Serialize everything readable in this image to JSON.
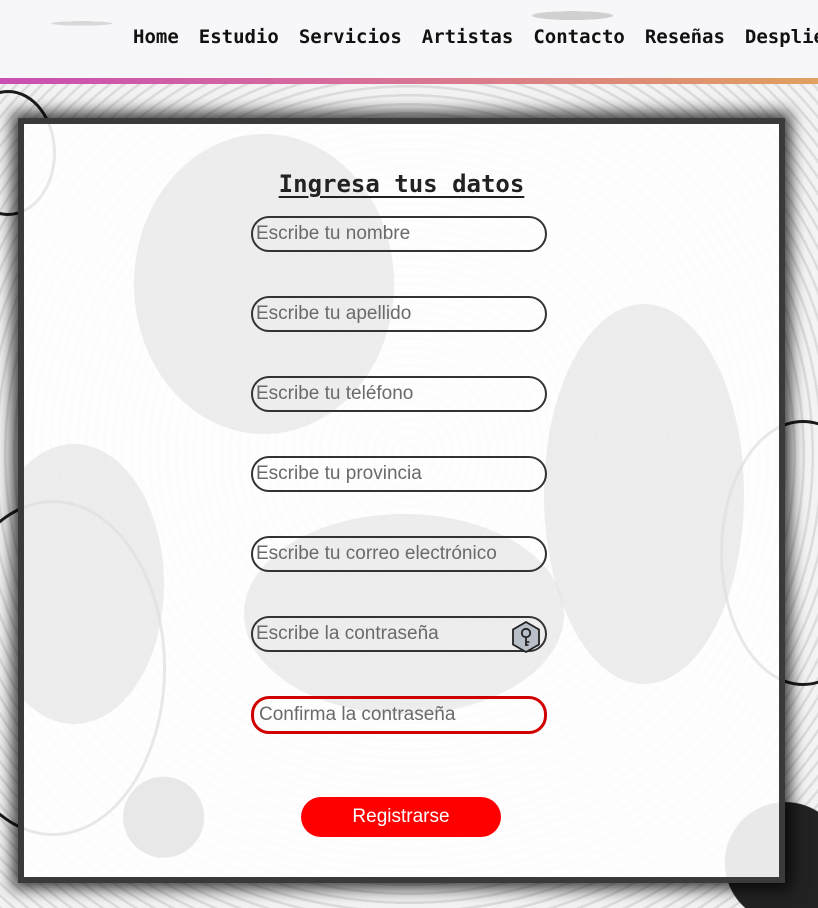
{
  "nav": {
    "links": [
      "Home",
      "Estudio",
      "Servicios",
      "Artistas",
      "Contacto",
      "Reseñas",
      "Despliég"
    ]
  },
  "form": {
    "title": "Ingresa tus datos",
    "fields": {
      "nombre": "Escribe tu nombre",
      "apellido": "Escribe tu apellido",
      "telefono": "Escribe tu teléfono",
      "provincia": "Escribe tu provincia",
      "correo": "Escribe tu correo electrónico",
      "contrasena": "Escribe la contraseña",
      "confirmar": "Confirma la contraseña"
    },
    "submit_label": "Registrarse",
    "error_color": "#d10000",
    "accent_color": "#ff0000"
  },
  "icons": {
    "password_toggle": "key-shield-icon"
  }
}
